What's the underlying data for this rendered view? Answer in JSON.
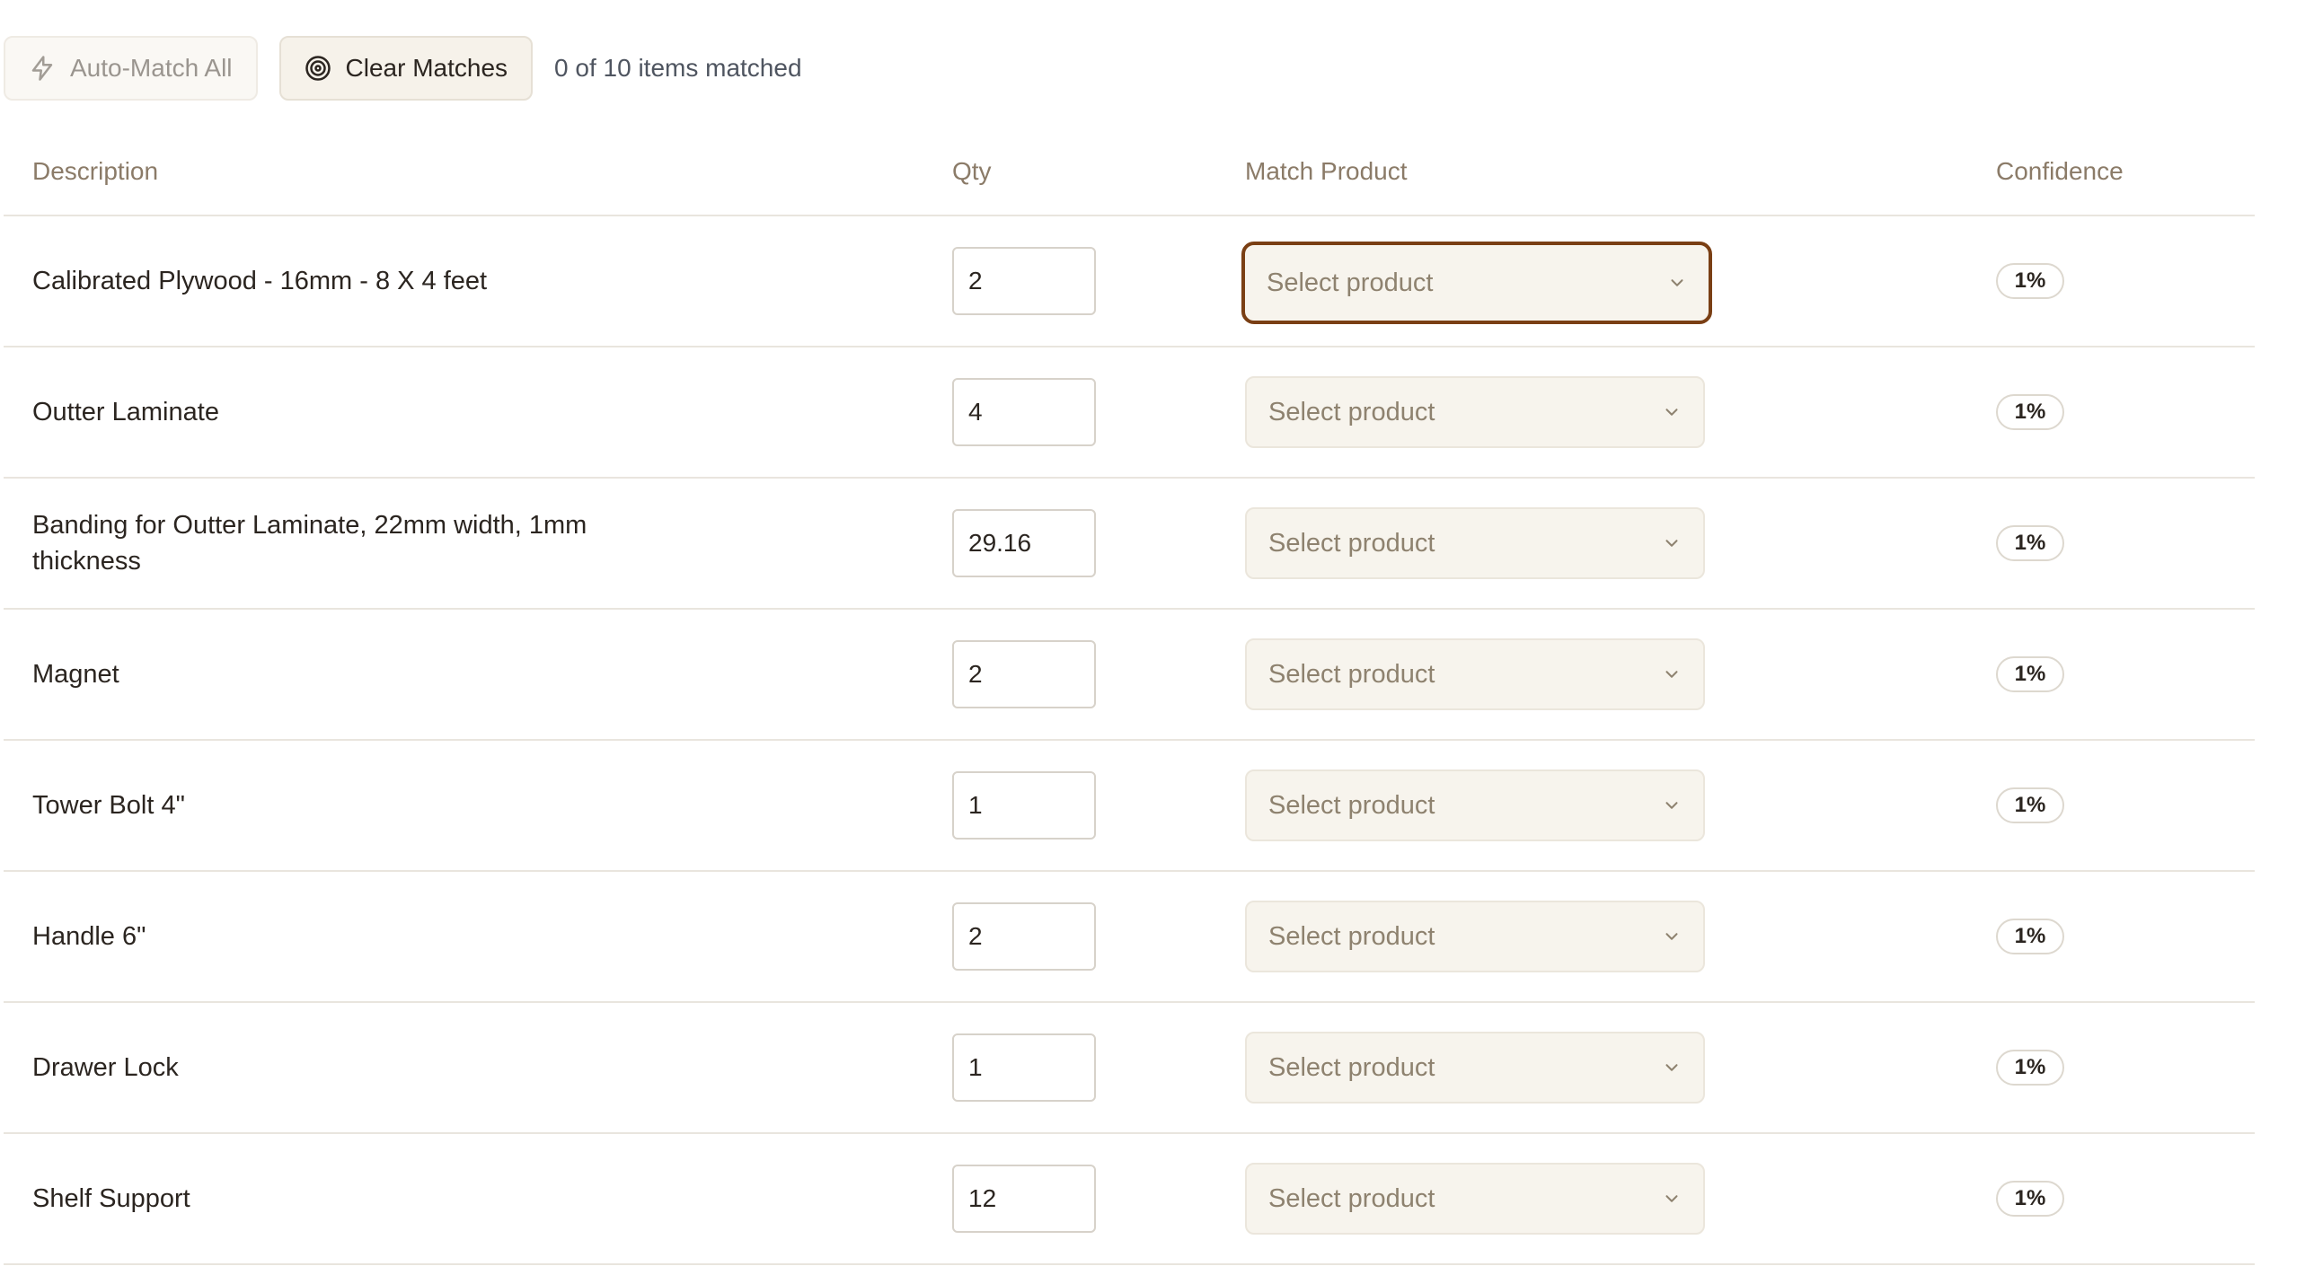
{
  "toolbar": {
    "auto_match_label": "Auto-Match All",
    "auto_match_icon": "lightning-icon",
    "clear_matches_label": "Clear Matches",
    "clear_matches_icon": "target-icon",
    "match_status": "0 of 10 items matched"
  },
  "table": {
    "headers": {
      "description": "Description",
      "qty": "Qty",
      "match_product": "Match Product",
      "confidence": "Confidence"
    },
    "rows": [
      {
        "description": "Calibrated Plywood - 16mm - 8 X 4 feet",
        "qty": "2",
        "product_placeholder": "Select product",
        "confidence": "1%",
        "focused": true
      },
      {
        "description": "Outter Laminate",
        "qty": "4",
        "product_placeholder": "Select product",
        "confidence": "1%",
        "focused": false
      },
      {
        "description": "Banding for Outter Laminate, 22mm width, 1mm thickness",
        "qty": "29.16",
        "product_placeholder": "Select product",
        "confidence": "1%",
        "focused": false
      },
      {
        "description": "Magnet",
        "qty": "2",
        "product_placeholder": "Select product",
        "confidence": "1%",
        "focused": false
      },
      {
        "description": "Tower Bolt 4\"",
        "qty": "1",
        "product_placeholder": "Select product",
        "confidence": "1%",
        "focused": false
      },
      {
        "description": "Handle 6\"",
        "qty": "2",
        "product_placeholder": "Select product",
        "confidence": "1%",
        "focused": false
      },
      {
        "description": "Drawer Lock",
        "qty": "1",
        "product_placeholder": "Select product",
        "confidence": "1%",
        "focused": false
      },
      {
        "description": "Shelf Support",
        "qty": "12",
        "product_placeholder": "Select product",
        "confidence": "1%",
        "focused": false
      }
    ]
  },
  "colors": {
    "accent_focus": "#7a3f14",
    "header_text": "#8b7b68",
    "select_bg": "#f7f4ed",
    "placeholder_text": "#8e826f"
  }
}
